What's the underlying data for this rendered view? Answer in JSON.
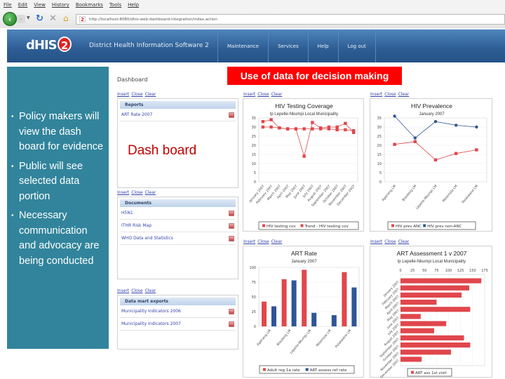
{
  "browser": {
    "menu": [
      "File",
      "Edit",
      "View",
      "History",
      "Bookmarks",
      "Tools",
      "Help"
    ],
    "url": "http://localhost:8080/dhis-web-dashboard-integration/index.action",
    "tab_badge": "2"
  },
  "header": {
    "logo_text": "dHIS",
    "logo_num": "2",
    "app_name": "District Health Information Software 2",
    "nav": [
      "Maintenance",
      "Services",
      "Help",
      "Log out"
    ]
  },
  "slide": {
    "banner": "Use of data for decision making",
    "overlay_label": "Dash board",
    "bullets": [
      "Policy makers will view the dash board for evidence",
      "Public will see selected data portion",
      "Necessary communication and advocacy are being conducted"
    ]
  },
  "dashboard": {
    "title": "Dashboard",
    "link_labels": [
      "Insert",
      "Close",
      "Clear"
    ],
    "reports": {
      "header": "Reports",
      "items": [
        "ART Rate 2007"
      ]
    },
    "documents": {
      "header": "Documents",
      "items": [
        "H5N1",
        "ITHR Risk Map",
        "WHO Data and Statistics"
      ]
    },
    "datamart": {
      "header": "Data mart exports",
      "items": [
        "Municipality Indicators 2006",
        "Municipality Indicators 2007"
      ]
    }
  },
  "colors": {
    "red_series": "#e0474c",
    "blue_series": "#2f5597",
    "banner": "#ff0000",
    "panel": "#31849b"
  },
  "chart_data": [
    {
      "type": "line",
      "title": "HIV Testing Coverage",
      "subtitle": "lp Lepelle-Nkumpi Local Municipality",
      "categories": [
        "January 2007",
        "February 2007",
        "March 2007",
        "April 2007",
        "May 2007",
        "June 2007",
        "July 2007",
        "August 2007",
        "September 2007",
        "October 2007",
        "November 2007",
        "December 2007"
      ],
      "ylim": [
        0,
        35
      ],
      "yticks": [
        0,
        5,
        10,
        15,
        20,
        25,
        30,
        35
      ],
      "series": [
        {
          "name": "HIV testing cov",
          "values": [
            33,
            34,
            29.5,
            29,
            29,
            14,
            32.5,
            29.5,
            30,
            30,
            32,
            27
          ]
        },
        {
          "name": "Trend - HIV testing cov",
          "values": [
            30,
            30,
            29.5,
            29,
            29,
            29,
            29,
            29,
            29,
            28.5,
            28.5,
            28
          ]
        }
      ],
      "legend": "bottom"
    },
    {
      "type": "line",
      "title": "HIV Prevalence",
      "subtitle": "January 2007",
      "categories": [
        "Aganang LM",
        "Blouberg LM",
        "Lepelle-Nkumpi LM",
        "Molemole LM",
        "Polokwane LM"
      ],
      "ylim": [
        0,
        35
      ],
      "yticks": [
        0,
        5,
        10,
        15,
        20,
        25,
        30,
        35
      ],
      "series": [
        {
          "name": "HIV prev ANC",
          "values": [
            20.5,
            22,
            12,
            15.5,
            17.5
          ]
        },
        {
          "name": "HIV prev non-ANC",
          "values": [
            36,
            24,
            33,
            31,
            30
          ]
        }
      ],
      "legend": "bottom"
    },
    {
      "type": "bar",
      "title": "ART Rate",
      "subtitle": "January 2007",
      "categories": [
        "Aganang LM",
        "Blouberg LM",
        "Lepelle-Nkumpi LM",
        "Molemole LM",
        "Polokwane LM"
      ],
      "ylim": [
        0,
        100
      ],
      "yticks": [
        0,
        25,
        50,
        75,
        100
      ],
      "series": [
        {
          "name": "Adult reg 1a rate",
          "values": [
            42,
            80,
            96,
            0,
            92
          ]
        },
        {
          "name": "ART assess ref rate",
          "values": [
            34,
            78,
            23,
            19,
            66
          ]
        }
      ],
      "legend": "bottom"
    },
    {
      "type": "bar",
      "orientation": "horizontal",
      "title": "ART Assessment 1 v 2007",
      "subtitle": "lp Lepelle-Nkumpi Local Municipality",
      "categories": [
        "January 2007",
        "February 2007",
        "March 2007",
        "April 2007",
        "May 2007",
        "June 2007",
        "July 2007",
        "August 2007",
        "September 2007",
        "October 2007",
        "November 2007",
        "December 2007"
      ],
      "xlim": [
        0,
        175
      ],
      "xticks": [
        0,
        25,
        50,
        75,
        100,
        125,
        150,
        175
      ],
      "series": [
        {
          "name": "ART ass 1st visit",
          "values": [
            168,
            143,
            127,
            75,
            145,
            42,
            95,
            70,
            132,
            145,
            105,
            44
          ]
        }
      ],
      "legend": "bottom"
    }
  ]
}
